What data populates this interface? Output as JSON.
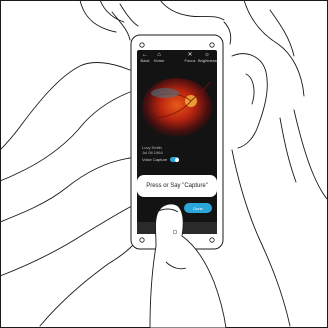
{
  "nav": {
    "back": {
      "icon": "arrow-left-icon",
      "label": "Back"
    },
    "home": {
      "icon": "home-icon",
      "label": "Home"
    },
    "focus": {
      "icon": "focus-icon",
      "label": "Focus"
    },
    "brightness": {
      "icon": "brightness-icon",
      "label": "Brightness"
    }
  },
  "patient": {
    "name": "Lucy Smith",
    "dob": "Jul 08 1964"
  },
  "voice_capture": {
    "label": "Voice Capture",
    "enabled": true
  },
  "prompt": {
    "text": "Press or Say \"Capture\""
  },
  "done_button": {
    "label": "Done"
  },
  "colors": {
    "accent": "#2aa6d8",
    "screen": "#131313",
    "phone_body": "#ffffff",
    "outline": "#1a1a1a"
  }
}
